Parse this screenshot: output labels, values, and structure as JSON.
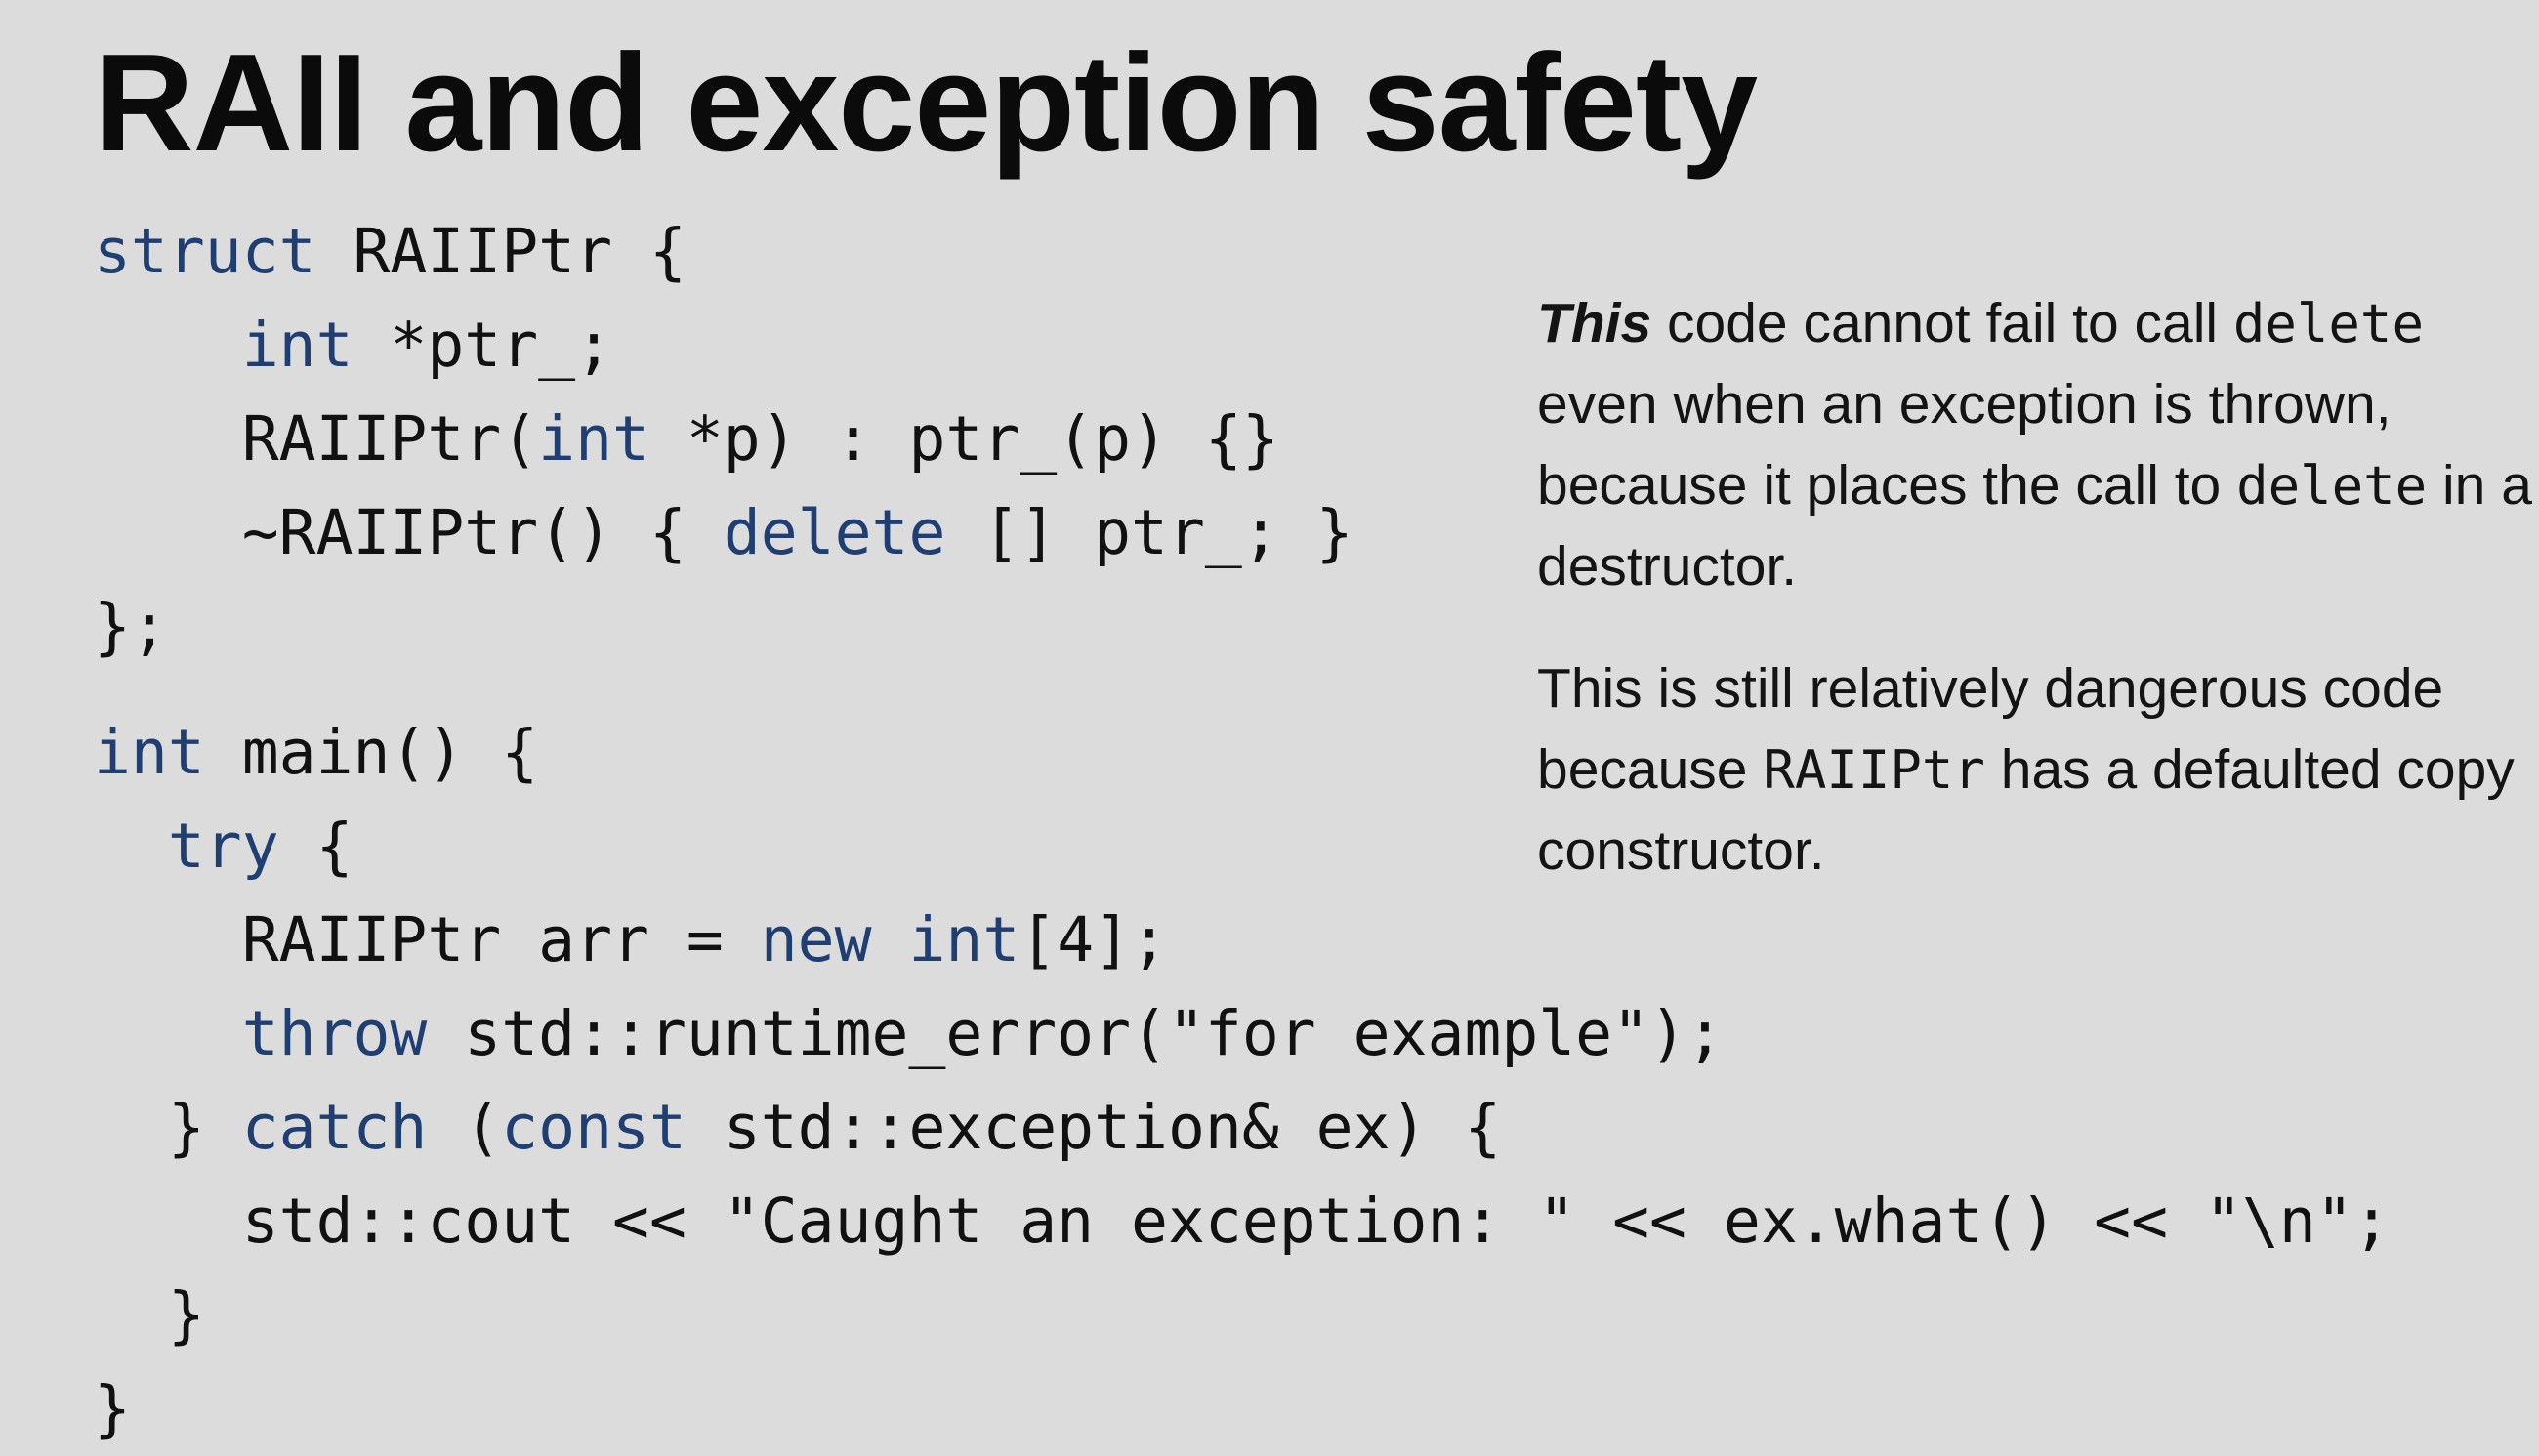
{
  "slide": {
    "title": "RAII and exception safety"
  },
  "code": {
    "lines": [
      {
        "indent": "",
        "tokens": [
          {
            "t": "struct",
            "kw": true
          },
          {
            "t": " RAIIPtr {",
            "kw": false
          }
        ]
      },
      {
        "indent": "    ",
        "tokens": [
          {
            "t": "int",
            "kw": true
          },
          {
            "t": " *ptr_;",
            "kw": false
          }
        ]
      },
      {
        "indent": "    ",
        "tokens": [
          {
            "t": "RAIIPtr(",
            "kw": false
          },
          {
            "t": "int",
            "kw": true
          },
          {
            "t": " *p) : ptr_(p) {}",
            "kw": false
          }
        ]
      },
      {
        "indent": "    ",
        "tokens": [
          {
            "t": "~RAIIPtr() { ",
            "kw": false
          },
          {
            "t": "delete",
            "kw": true
          },
          {
            "t": " [] ptr_; }",
            "kw": false
          }
        ]
      },
      {
        "indent": "",
        "tokens": [
          {
            "t": "};",
            "kw": false
          }
        ]
      },
      {
        "indent": "",
        "tokens": [
          {
            "t": "int",
            "kw": true
          },
          {
            "t": " main() {",
            "kw": false
          }
        ]
      },
      {
        "indent": "  ",
        "tokens": [
          {
            "t": "try",
            "kw": true
          },
          {
            "t": " {",
            "kw": false
          }
        ]
      },
      {
        "indent": "    ",
        "tokens": [
          {
            "t": "RAIIPtr arr = ",
            "kw": false
          },
          {
            "t": "new",
            "kw": true
          },
          {
            "t": " ",
            "kw": false
          },
          {
            "t": "int",
            "kw": true
          },
          {
            "t": "[4];",
            "kw": false
          }
        ]
      },
      {
        "indent": "    ",
        "tokens": [
          {
            "t": "throw",
            "kw": true
          },
          {
            "t": " std::runtime_error(\"for example\");",
            "kw": false
          }
        ]
      },
      {
        "indent": "  ",
        "tokens": [
          {
            "t": "} ",
            "kw": false
          },
          {
            "t": "catch",
            "kw": true
          },
          {
            "t": " (",
            "kw": false
          },
          {
            "t": "const",
            "kw": true
          },
          {
            "t": " std::exception& ex) {",
            "kw": false
          }
        ]
      },
      {
        "indent": "    ",
        "tokens": [
          {
            "t": "std::cout << \"Caught an exception: \" << ex.what() << \"\\n\";",
            "kw": false
          }
        ]
      },
      {
        "indent": "  ",
        "tokens": [
          {
            "t": "}",
            "kw": false
          }
        ]
      },
      {
        "indent": "",
        "tokens": [
          {
            "t": "}",
            "kw": false
          }
        ]
      }
    ]
  },
  "note": {
    "para1": {
      "emph": "This",
      "text_a": " code cannot fail to call ",
      "code_a": "delete",
      "text_b": " even when an exception is thrown, because it places the call to ",
      "code_b": "delete",
      "text_c": " in a destructor."
    },
    "para2": {
      "text_a": "This is still relatively dangerous code because ",
      "code_a": "RAIIPtr",
      "text_b": " has a defaulted copy constructor."
    }
  },
  "colors": {
    "background": "#dcdcdc",
    "keyword": "#1f3f73",
    "text": "#111111"
  }
}
